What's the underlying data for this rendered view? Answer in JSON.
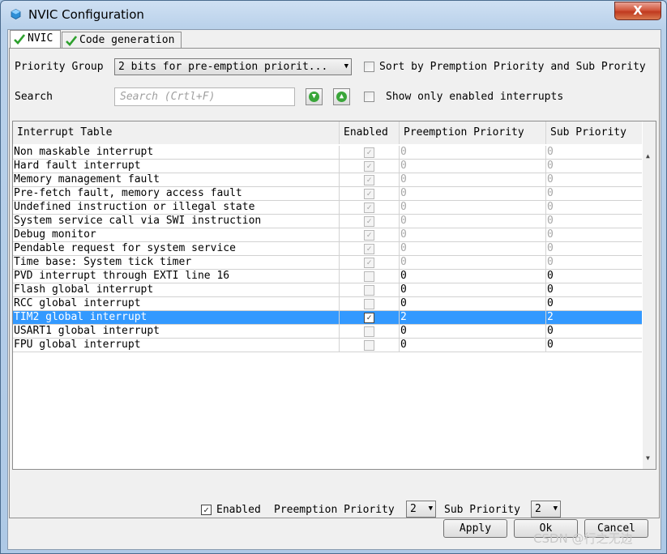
{
  "window": {
    "title": "NVIC Configuration",
    "close_label": "X"
  },
  "tabs": [
    {
      "label": "NVIC",
      "active": true
    },
    {
      "label": "Code generation",
      "active": false
    }
  ],
  "toolbar": {
    "priority_group_label": "Priority Group",
    "priority_group_value": "2 bits for pre-emption priorit...",
    "sort_label": "Sort by Premption Priority and Sub Prority",
    "search_label": "Search",
    "search_placeholder": "Search (Crtl+F)",
    "show_enabled_label": "Show only enabled interrupts"
  },
  "table": {
    "columns": [
      "Interrupt Table",
      "Enabled",
      "Preemption Priority",
      "Sub Priority"
    ],
    "rows": [
      {
        "name": "Non maskable interrupt",
        "enabled": true,
        "locked": true,
        "preemption": "0",
        "sub": "0"
      },
      {
        "name": "Hard fault interrupt",
        "enabled": true,
        "locked": true,
        "preemption": "0",
        "sub": "0"
      },
      {
        "name": "Memory management fault",
        "enabled": true,
        "locked": true,
        "preemption": "0",
        "sub": "0"
      },
      {
        "name": "Pre-fetch fault, memory access fault",
        "enabled": true,
        "locked": true,
        "preemption": "0",
        "sub": "0"
      },
      {
        "name": "Undefined instruction or illegal state",
        "enabled": true,
        "locked": true,
        "preemption": "0",
        "sub": "0"
      },
      {
        "name": "System service call via SWI instruction",
        "enabled": true,
        "locked": true,
        "preemption": "0",
        "sub": "0"
      },
      {
        "name": "Debug monitor",
        "enabled": true,
        "locked": true,
        "preemption": "0",
        "sub": "0"
      },
      {
        "name": "Pendable request for system service",
        "enabled": true,
        "locked": true,
        "preemption": "0",
        "sub": "0"
      },
      {
        "name": "Time base: System tick timer",
        "enabled": true,
        "locked": true,
        "preemption": "0",
        "sub": "0"
      },
      {
        "name": "PVD interrupt through EXTI line 16",
        "enabled": false,
        "locked": false,
        "preemption": "0",
        "sub": "0"
      },
      {
        "name": "Flash global interrupt",
        "enabled": false,
        "locked": false,
        "preemption": "0",
        "sub": "0"
      },
      {
        "name": "RCC global interrupt",
        "enabled": false,
        "locked": false,
        "preemption": "0",
        "sub": "0"
      },
      {
        "name": "TIM2 global interrupt",
        "enabled": true,
        "locked": false,
        "selected": true,
        "preemption": "2",
        "sub": "2"
      },
      {
        "name": "USART1 global interrupt",
        "enabled": false,
        "locked": false,
        "preemption": "0",
        "sub": "0"
      },
      {
        "name": "FPU global interrupt",
        "enabled": false,
        "locked": false,
        "preemption": "0",
        "sub": "0"
      }
    ]
  },
  "detail": {
    "enabled_label": "Enabled",
    "preemption_label": "Preemption Priority",
    "preemption_value": "2",
    "sub_label": "Sub Priority",
    "sub_value": "2"
  },
  "buttons": {
    "apply": "Apply",
    "ok": "Ok",
    "cancel": "Cancel"
  },
  "watermark": "CSDN @行之无边",
  "colors": {
    "selection": "#3399ff",
    "close": "#c8452a"
  }
}
